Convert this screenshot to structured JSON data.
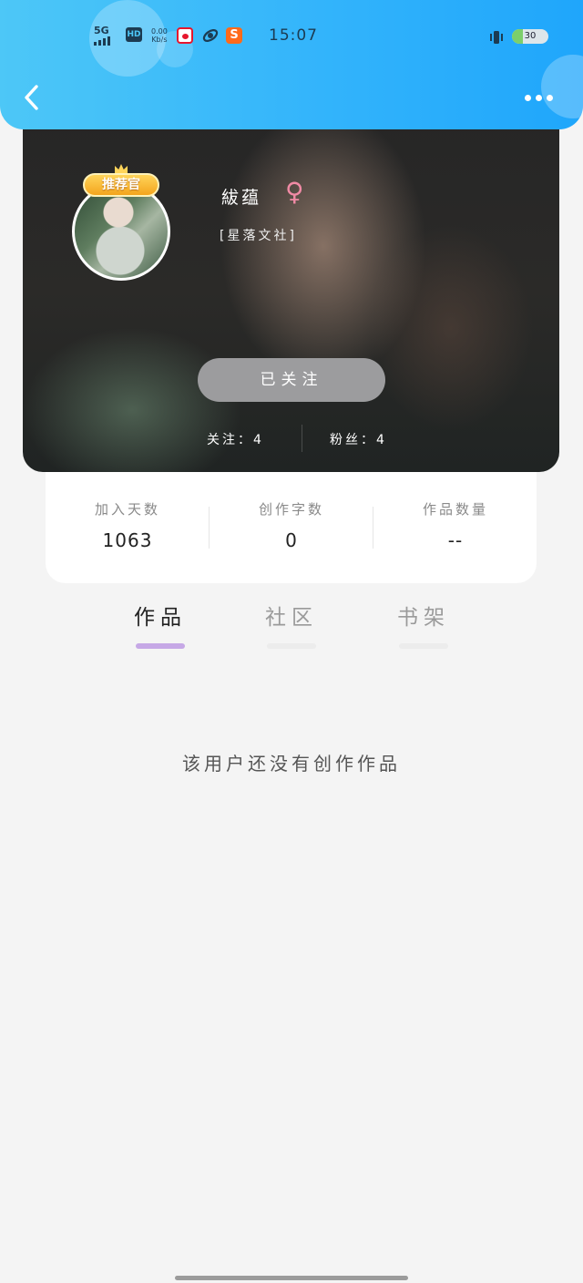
{
  "status_bar": {
    "signal": "5G",
    "hd": "HD",
    "net_speed_value": "0.00",
    "net_speed_unit": "Kb/s",
    "time": "15:07",
    "battery": "30",
    "battery_level": 0.3
  },
  "header": {
    "back_icon": "chevron-left-icon",
    "more_icon": "more-dots-icon"
  },
  "profile": {
    "badge": "推荐官",
    "nickname": "紱蕴",
    "gender_symbol": "♀",
    "organization": "[星落文社]",
    "follow_button": "已关注",
    "following": "关注：4",
    "fans": "粉丝：4"
  },
  "stats": [
    {
      "label": "加入天数",
      "value": "1063"
    },
    {
      "label": "创作字数",
      "value": "0"
    },
    {
      "label": "作品数量",
      "value": "--"
    }
  ],
  "tabs": [
    {
      "label": "作品",
      "active": true
    },
    {
      "label": "社区",
      "active": false
    },
    {
      "label": "书架",
      "active": false
    }
  ],
  "empty_message": "该用户还没有创作作品",
  "colors": {
    "header_start": "#4dc7f7",
    "header_end": "#1fa6fb",
    "active_tab_underline": "#c6a8e6",
    "gender_pink": "#f08aa5"
  }
}
